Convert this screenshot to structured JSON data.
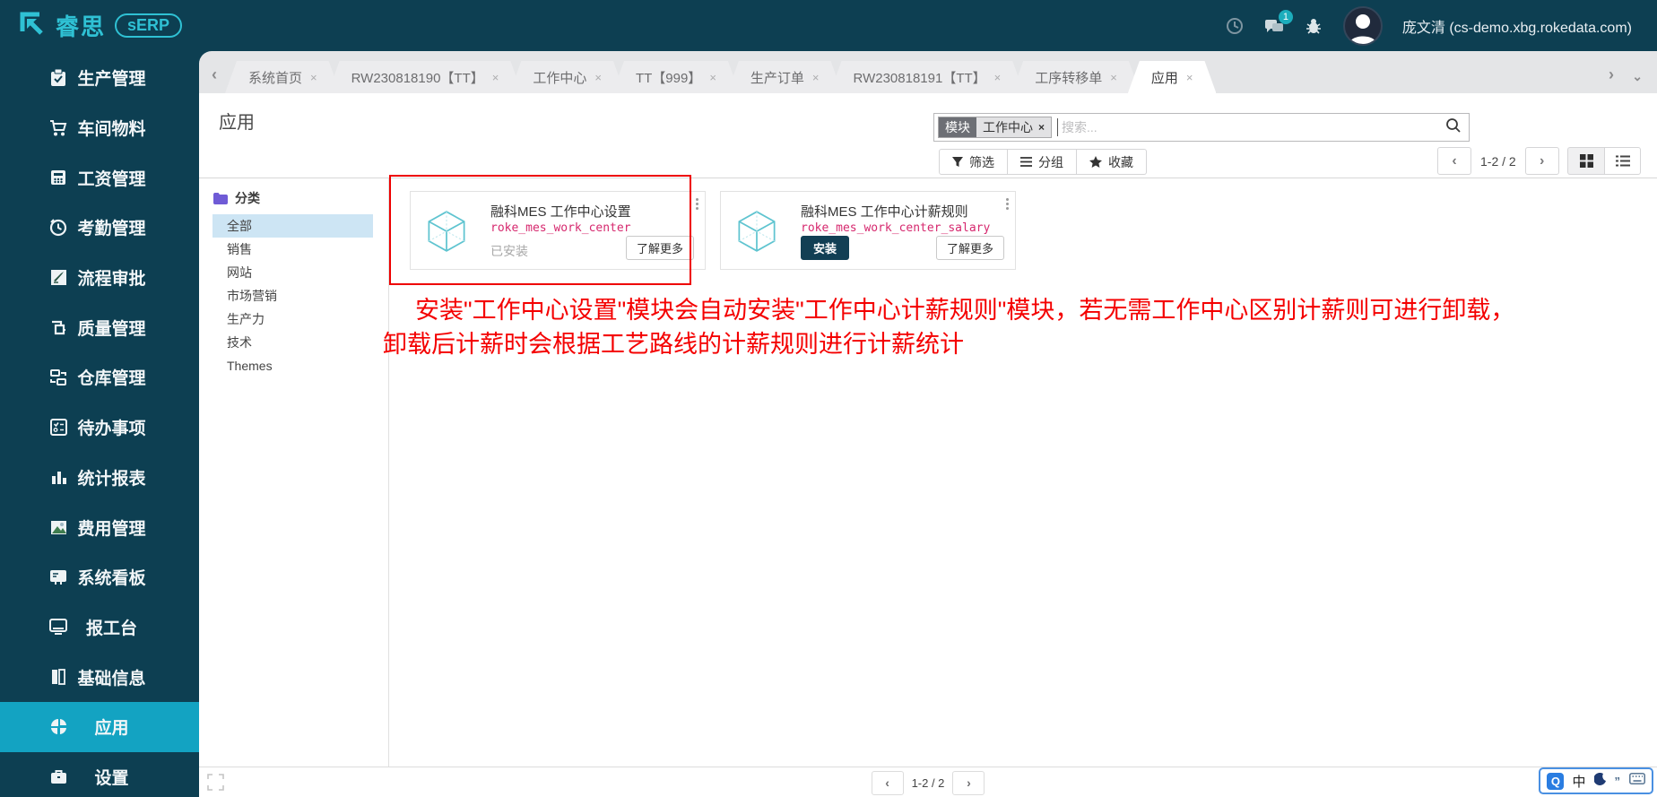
{
  "topbar": {
    "logo_text": "睿思",
    "logo_badge": "sERP",
    "chat_count": "1",
    "username": "庞文清 (cs-demo.xbg.rokedata.com)"
  },
  "sidebar": {
    "items": [
      {
        "label": "生产管理",
        "icon": "clipboard-check-icon",
        "active": false
      },
      {
        "label": "车间物料",
        "icon": "cart-icon",
        "active": false
      },
      {
        "label": "工资管理",
        "icon": "calculator-icon",
        "active": false
      },
      {
        "label": "考勤管理",
        "icon": "clock-icon",
        "active": false
      },
      {
        "label": "流程审批",
        "icon": "approval-icon",
        "active": false
      },
      {
        "label": "质量管理",
        "icon": "caliper-icon",
        "active": false
      },
      {
        "label": "仓库管理",
        "icon": "warehouse-icon",
        "active": false
      },
      {
        "label": "待办事项",
        "icon": "todo-icon",
        "active": false
      },
      {
        "label": "统计报表",
        "icon": "bar-chart-icon",
        "active": false
      },
      {
        "label": "费用管理",
        "icon": "expense-image-icon",
        "active": false
      },
      {
        "label": "系统看板",
        "icon": "dashboard-icon",
        "active": false
      },
      {
        "label": "报工台",
        "icon": "monitor-icon",
        "active": false
      },
      {
        "label": "基础信息",
        "icon": "book-icon",
        "active": false
      },
      {
        "label": "应用",
        "icon": "apps-icon",
        "active": true
      },
      {
        "label": "设置",
        "icon": "briefcase-icon",
        "active": false
      }
    ]
  },
  "tabbar": {
    "close_glyph": "×",
    "tabs": [
      {
        "label": "系统首页",
        "active": false
      },
      {
        "label": "RW230818190【TT】",
        "active": false
      },
      {
        "label": "工作中心",
        "active": false
      },
      {
        "label": "TT【999】",
        "active": false
      },
      {
        "label": "生产订单",
        "active": false
      },
      {
        "label": "RW230818191【TT】",
        "active": false
      },
      {
        "label": "工序转移单",
        "active": false
      },
      {
        "label": "应用",
        "active": true
      }
    ],
    "prev_glyph": "‹",
    "next_glyph": "›",
    "caret_glyph": "⌄"
  },
  "control": {
    "page_title": "应用",
    "facet_label": "模块",
    "facet_value": "工作中心",
    "facet_remove": "×",
    "search_placeholder": "搜索...",
    "filter_label": "筛选",
    "group_label": "分组",
    "favorite_label": "收藏",
    "pager_prev": "‹",
    "pager_text": "1-2 / 2",
    "pager_next": "›"
  },
  "categories": {
    "header": "分类",
    "items": [
      {
        "label": "全部",
        "selected": true
      },
      {
        "label": "销售",
        "selected": false
      },
      {
        "label": "网站",
        "selected": false
      },
      {
        "label": "市场营销",
        "selected": false
      },
      {
        "label": "生产力",
        "selected": false
      },
      {
        "label": "技术",
        "selected": false
      },
      {
        "label": "Themes",
        "selected": false
      }
    ]
  },
  "modules": [
    {
      "title": "融科MES 工作中心设置",
      "tech_name": "roke_mes_work_center",
      "status": "已安装",
      "more_label": "了解更多"
    },
    {
      "title": "融科MES 工作中心计薪规则",
      "tech_name": "roke_mes_work_center_salary",
      "install_label": "安装",
      "more_label": "了解更多"
    }
  ],
  "annotation": {
    "line1": "安装\"工作中心设置\"模块会自动安装\"工作中心计薪规则\"模块，若无需工作中心区别计薪则可进行卸载，",
    "line2": "卸载后计薪时会根据工艺路线的计薪规则进行计薪统计"
  },
  "footer": {
    "pager_prev": "‹",
    "pager_text": "1-2 / 2",
    "pager_next": "›"
  },
  "ime": {
    "input_icon": "Q",
    "lang_indicator": "中",
    "quotes": "”"
  },
  "colors": {
    "brand_dark": "#0d3f52",
    "accent_cyan": "#13a3c2",
    "logo_cyan": "#2fc1d4",
    "tech_pink": "#d6286e",
    "annotation_red": "#ee0000",
    "install_button": "#123f54",
    "category_selected": "#cde5f4"
  }
}
